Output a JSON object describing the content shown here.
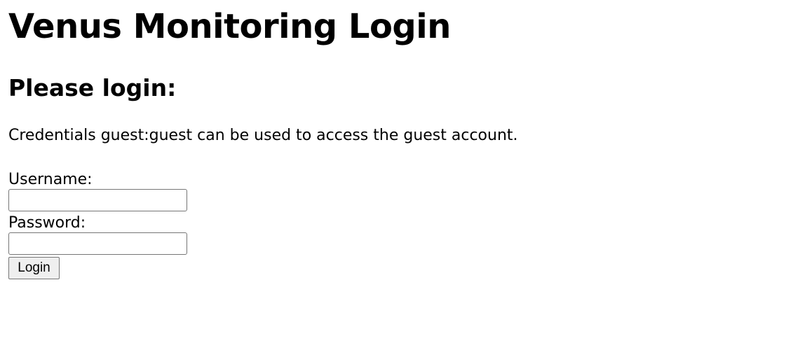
{
  "page": {
    "title": "Venus Monitoring Login",
    "subtitle": "Please login:",
    "hint": "Credentials guest:guest can be used to access the guest account."
  },
  "form": {
    "username_label": "Username:",
    "username_value": "",
    "password_label": "Password:",
    "password_value": "",
    "submit_label": "Login"
  }
}
